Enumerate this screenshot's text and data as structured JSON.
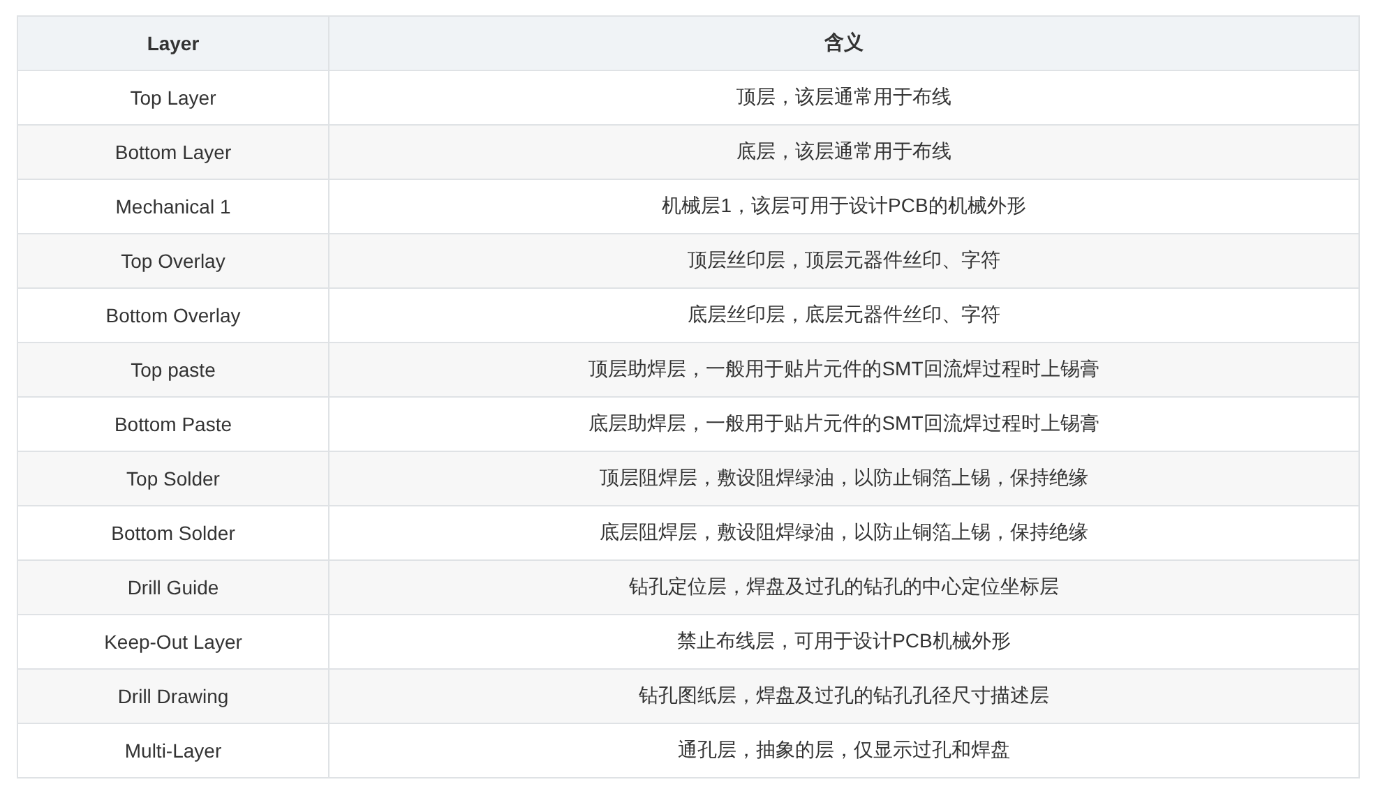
{
  "table": {
    "columns": [
      "Layer",
      "含义"
    ],
    "rows": [
      [
        "Top Layer",
        "顶层，该层通常用于布线"
      ],
      [
        "Bottom Layer",
        "底层，该层通常用于布线"
      ],
      [
        "Mechanical 1",
        "机械层1，该层可用于设计PCB的机械外形"
      ],
      [
        "Top Overlay",
        "顶层丝印层，顶层元器件丝印、字符"
      ],
      [
        "Bottom Overlay",
        "底层丝印层，底层元器件丝印、字符"
      ],
      [
        "Top paste",
        "顶层助焊层，一般用于贴片元件的SMT回流焊过程时上锡膏"
      ],
      [
        "Bottom Paste",
        "底层助焊层，一般用于贴片元件的SMT回流焊过程时上锡膏"
      ],
      [
        "Top Solder",
        "顶层阻焊层，敷设阻焊绿油，以防止铜箔上锡，保持绝缘"
      ],
      [
        "Bottom Solder",
        "底层阻焊层，敷设阻焊绿油，以防止铜箔上锡，保持绝缘"
      ],
      [
        "Drill Guide",
        "钻孔定位层，焊盘及过孔的钻孔的中心定位坐标层"
      ],
      [
        "Keep-Out Layer",
        "禁止布线层，可用于设计PCB机械外形"
      ],
      [
        "Drill Drawing",
        "钻孔图纸层，焊盘及过孔的钻孔孔径尺寸描述层"
      ],
      [
        "Multi-Layer",
        "通孔层，抽象的层，仅显示过孔和焊盘"
      ]
    ]
  }
}
